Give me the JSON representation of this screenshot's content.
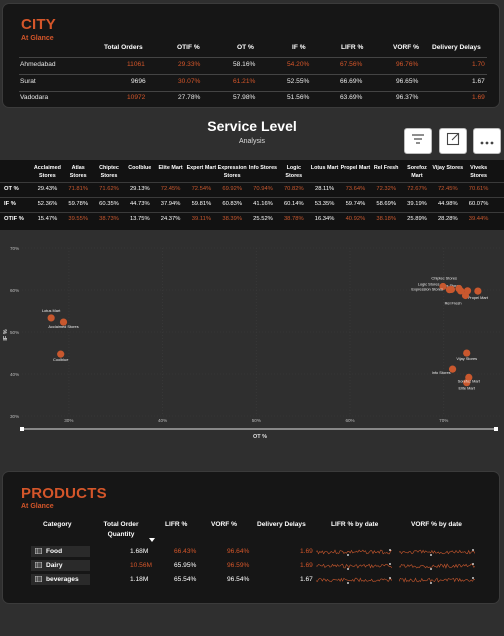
{
  "city": {
    "title": "CITY",
    "subtitle": "At Glance",
    "headers": [
      "Total Orders",
      "OTIF %",
      "OT %",
      "IF %",
      "LIFR %",
      "VORF %",
      "Delivery Delays"
    ],
    "rows": [
      {
        "name": "Ahmedabad",
        "total_orders": "11061",
        "otif": "29.33%",
        "ot": "58.16%",
        "if": "54.20%",
        "lifr": "67.56%",
        "vorf": "96.76%",
        "delays": "1.70"
      },
      {
        "name": "Surat",
        "total_orders": "9696",
        "otif": "30.07%",
        "ot": "61.21%",
        "if": "52.55%",
        "lifr": "66.69%",
        "vorf": "96.65%",
        "delays": "1.67"
      },
      {
        "name": "Vadodara",
        "total_orders": "10972",
        "otif": "27.78%",
        "ot": "57.98%",
        "if": "51.56%",
        "lifr": "63.69%",
        "vorf": "96.37%",
        "delays": "1.69"
      }
    ]
  },
  "service": {
    "title": "Service Level",
    "subtitle": "Analysis",
    "toolbar": {
      "filter_icon": "filter-icon",
      "focus_icon": "focus-mode-icon",
      "more_icon": "more-options-icon"
    },
    "columns": [
      "Acclaimed Stores",
      "Atlas Stores",
      "Chiptec Stores",
      "Coolblue",
      "Elite Mart",
      "Expert Mart",
      "Expression Stores",
      "Info Stores",
      "Logic Stores",
      "Lotus Mart",
      "Propel Mart",
      "Rel Fresh",
      "Sorefoz Mart",
      "Vijay Stores",
      "Viveks Stores"
    ],
    "rows": [
      {
        "label": "OT %",
        "values": [
          "29.43%",
          "71.81%",
          "71.62%",
          "29.13%",
          "72.45%",
          "72.54%",
          "69.92%",
          "70.94%",
          "70.82%",
          "28.11%",
          "73.64%",
          "72.32%",
          "72.67%",
          "72.45%",
          "70.61%"
        ]
      },
      {
        "label": "IF %",
        "values": [
          "52.36%",
          "59.78%",
          "60.35%",
          "44.73%",
          "37.94%",
          "59.81%",
          "60.83%",
          "41.16%",
          "60.14%",
          "53.35%",
          "59.74%",
          "58.69%",
          "39.19%",
          "44.98%",
          "60.07%"
        ]
      },
      {
        "label": "OTIF %",
        "values": [
          "15.47%",
          "39.55%",
          "38.73%",
          "13.75%",
          "24.37%",
          "39.11%",
          "38.39%",
          "25.52%",
          "38.78%",
          "16.34%",
          "40.92%",
          "38.18%",
          "25.89%",
          "28.28%",
          "39.44%"
        ]
      }
    ]
  },
  "chart_data": {
    "type": "scatter",
    "xlabel": "OT %",
    "ylabel": "IF %",
    "xlim": [
      25,
      76
    ],
    "ylim": [
      30,
      70
    ],
    "xticks": [
      "30%",
      "40%",
      "50%",
      "60%",
      "70%"
    ],
    "xtick_values": [
      30,
      40,
      50,
      60,
      70
    ],
    "yticks": [
      "70%",
      "60%",
      "50%",
      "40%",
      "30%"
    ],
    "ytick_values": [
      70,
      60,
      50,
      40,
      30
    ],
    "point_color": "#c9582e",
    "points": [
      {
        "label": "Acclaimed Stores",
        "x": 29.43,
        "y": 52.36
      },
      {
        "label": "Atlas Stores",
        "x": 71.81,
        "y": 59.78
      },
      {
        "label": "Chiptec Stores",
        "x": 71.62,
        "y": 60.35
      },
      {
        "label": "Coolblue",
        "x": 29.13,
        "y": 44.73
      },
      {
        "label": "Elite Mart",
        "x": 72.45,
        "y": 37.94
      },
      {
        "label": "Expert Mart",
        "x": 72.54,
        "y": 59.81
      },
      {
        "label": "Expression Stores",
        "x": 69.92,
        "y": 60.83
      },
      {
        "label": "Info Stores",
        "x": 70.94,
        "y": 41.16
      },
      {
        "label": "Logic Stores",
        "x": 70.82,
        "y": 60.14
      },
      {
        "label": "Lotus Mart",
        "x": 28.11,
        "y": 53.35
      },
      {
        "label": "Propel Mart",
        "x": 73.64,
        "y": 59.74
      },
      {
        "label": "Rel Fresh",
        "x": 72.32,
        "y": 58.69
      },
      {
        "label": "Sorefoz Mart",
        "x": 72.67,
        "y": 39.19
      },
      {
        "label": "Vijay Stores",
        "x": 72.45,
        "y": 44.98
      },
      {
        "label": "Viveks Stores",
        "x": 70.61,
        "y": 60.07
      }
    ]
  },
  "products": {
    "title": "PRODUCTS",
    "subtitle": "At Glance",
    "headers": [
      "Category",
      "Total Order Quantity",
      "LIFR %",
      "VORF %",
      "Delivery Delays",
      "LIFR % by date",
      "VORF % by date"
    ],
    "sort_icon": "sort-desc-icon",
    "category_icon": "table-icon",
    "rows": [
      {
        "name": "Food",
        "qty": "1.68M",
        "lifr": "66.43%",
        "vorf": "96.64%",
        "delays": "1.69"
      },
      {
        "name": "Dairy",
        "qty": "10.56M",
        "lifr": "65.95%",
        "vorf": "96.59%",
        "delays": "1.69"
      },
      {
        "name": "beverages",
        "qty": "1.18M",
        "lifr": "65.54%",
        "vorf": "96.54%",
        "delays": "1.67"
      }
    ]
  }
}
